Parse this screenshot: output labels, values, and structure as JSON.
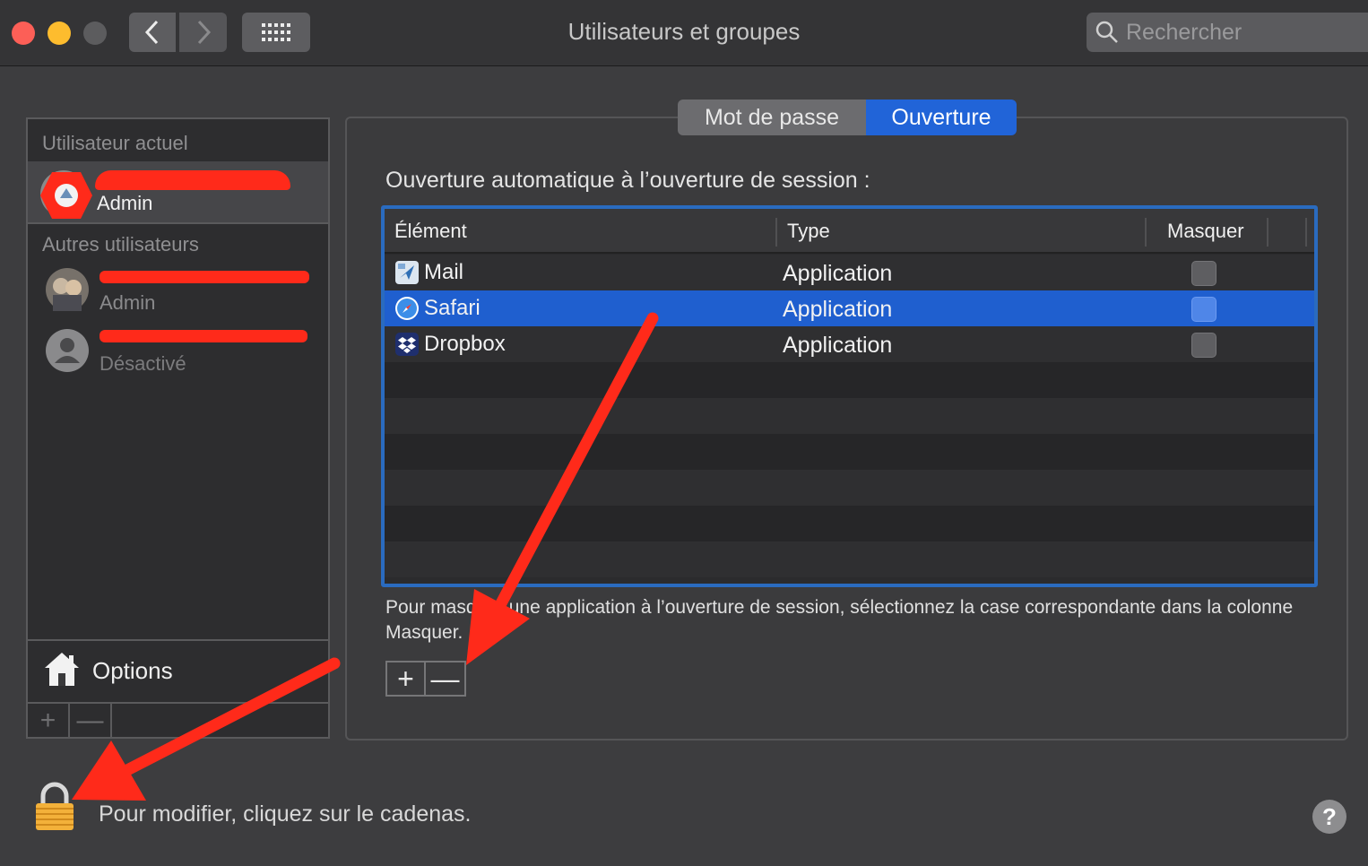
{
  "window": {
    "title": "Utilisateurs et groupes"
  },
  "search": {
    "placeholder": "Rechercher"
  },
  "users": {
    "current_header": "Utilisateur actuel",
    "current": {
      "role": "Admin"
    },
    "others_header": "Autres utilisateurs",
    "others": [
      {
        "role": "Admin"
      },
      {
        "role": "Désactivé"
      }
    ],
    "options_label": "Options",
    "add_label": "+",
    "remove_label": "—"
  },
  "tabs": [
    {
      "label": "Mot de passe",
      "selected": false
    },
    {
      "label": "Ouverture",
      "selected": true
    }
  ],
  "login_items": {
    "heading": "Ouverture automatique à l’ouverture de session :",
    "columns": [
      "Élément",
      "Type",
      "Masquer"
    ],
    "rows": [
      {
        "name": "Mail",
        "type": "Application",
        "icon": "mail-app-icon",
        "hide": false,
        "selected": false
      },
      {
        "name": "Safari",
        "type": "Application",
        "icon": "safari-app-icon",
        "hide": false,
        "selected": true
      },
      {
        "name": "Dropbox",
        "type": "Application",
        "icon": "dropbox-app-icon",
        "hide": false,
        "selected": false
      }
    ],
    "hint": "Pour masquer une application à l’ouverture de session, sélectionnez la case correspondante dans la colonne Masquer.",
    "add_label": "+",
    "remove_label": "—"
  },
  "footer": {
    "lock_hint": "Pour modifier, cliquez sur le cadenas.",
    "help_label": "?"
  },
  "colors": {
    "accent": "#2164d8",
    "annotation": "#ff2a1a"
  }
}
